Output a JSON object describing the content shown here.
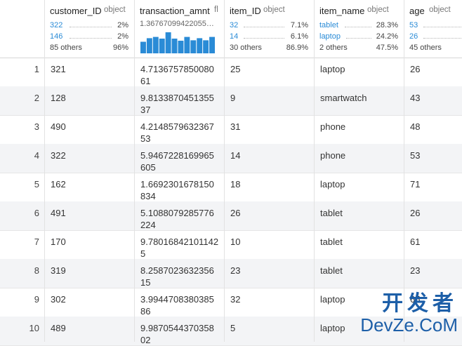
{
  "columns": [
    {
      "name": "customer_ID",
      "type": "object"
    },
    {
      "name": "transaction_amnt",
      "type": "fl"
    },
    {
      "name": "item_ID",
      "type": "object"
    },
    {
      "name": "item_name",
      "type": "object"
    },
    {
      "name": "age",
      "type": "object"
    }
  ],
  "summary": {
    "customer_ID": [
      {
        "label": "322",
        "pct": "2%"
      },
      {
        "label": "146",
        "pct": "2%"
      },
      {
        "label": "85 others",
        "pct": "96%"
      }
    ],
    "transaction_amnt": {
      "top_value": "1.36767099422055…",
      "histogram": [
        0.55,
        0.72,
        0.78,
        0.7,
        1.0,
        0.7,
        0.6,
        0.78,
        0.62,
        0.72,
        0.62,
        0.78
      ]
    },
    "item_ID": [
      {
        "label": "32",
        "pct": "7.1%"
      },
      {
        "label": "14",
        "pct": "6.1%"
      },
      {
        "label": "30 others",
        "pct": "86.9%"
      }
    ],
    "item_name": [
      {
        "label": "tablet",
        "pct": "28.3%"
      },
      {
        "label": "laptop",
        "pct": "24.2%"
      },
      {
        "label": "2 others",
        "pct": "47.5%"
      }
    ],
    "age": [
      {
        "label": "53",
        "pct": ""
      },
      {
        "label": "26",
        "pct": ""
      },
      {
        "label": "45 others",
        "pct": ""
      }
    ]
  },
  "rows": [
    {
      "index": "1",
      "customer_ID": "321",
      "transaction_amnt": "4.713675785008061",
      "item_ID": "25",
      "item_name": "laptop",
      "age": "26"
    },
    {
      "index": "2",
      "customer_ID": "128",
      "transaction_amnt": "9.813387045135537",
      "item_ID": "9",
      "item_name": "smartwatch",
      "age": "43"
    },
    {
      "index": "3",
      "customer_ID": "490",
      "transaction_amnt": "4.214857963236753",
      "item_ID": "31",
      "item_name": "phone",
      "age": "48"
    },
    {
      "index": "4",
      "customer_ID": "322",
      "transaction_amnt": "5.9467228169965605",
      "item_ID": "14",
      "item_name": "phone",
      "age": "53"
    },
    {
      "index": "5",
      "customer_ID": "162",
      "transaction_amnt": "1.6692301678150834",
      "item_ID": "18",
      "item_name": "laptop",
      "age": "71"
    },
    {
      "index": "6",
      "customer_ID": "491",
      "transaction_amnt": "5.1088079285776224",
      "item_ID": "26",
      "item_name": "tablet",
      "age": "26"
    },
    {
      "index": "7",
      "customer_ID": "170",
      "transaction_amnt": "9.780168421011425",
      "item_ID": "10",
      "item_name": "tablet",
      "age": "61"
    },
    {
      "index": "8",
      "customer_ID": "319",
      "transaction_amnt": "8.258702363235615",
      "item_ID": "23",
      "item_name": "tablet",
      "age": "23"
    },
    {
      "index": "9",
      "customer_ID": "302",
      "transaction_amnt": "3.994470838038586",
      "item_ID": "32",
      "item_name": "laptop",
      "age": "65"
    },
    {
      "index": "10",
      "customer_ID": "489",
      "transaction_amnt": "9.987054437035802",
      "item_ID": "5",
      "item_name": "laptop",
      "age": ""
    }
  ],
  "watermark": {
    "cn": "开发者",
    "en": "DevZe.CoM"
  },
  "colors": {
    "accent": "#2a8bd6",
    "row_alt": "#f3f4f6",
    "watermark": "#1d5fa8"
  }
}
